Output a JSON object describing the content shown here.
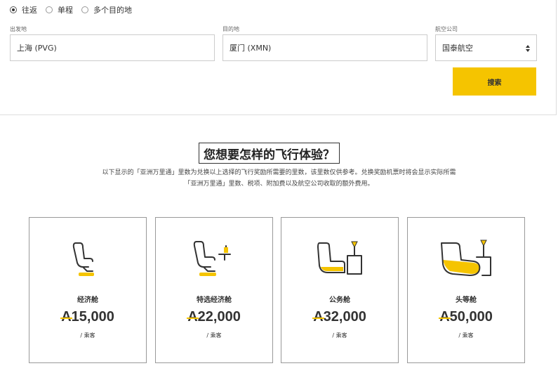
{
  "search": {
    "trip_types": [
      {
        "label": "往返",
        "checked": true
      },
      {
        "label": "单程",
        "checked": false
      },
      {
        "label": "多个目的地",
        "checked": false
      }
    ],
    "origin_label": "出发地",
    "origin_value": "上海 (PVG)",
    "destination_label": "目的地",
    "destination_value": "厦门 (XMN)",
    "airline_label": "航空公司",
    "airline_value": "国泰航空",
    "search_button": "搜索"
  },
  "experience": {
    "title": "您想要怎样的飞行体验？",
    "description_line1": "以下显示的「亚洲万里通」里数为兑换以上选择的飞行奖励所需要的里数，该里数仅供参考。兑换奖励机票时将会显示实际所需",
    "description_line2": "「亚洲万里通」里数、税项、附加费以及航空公司收取的额外费用。"
  },
  "cabins": [
    {
      "icon": "economy-seat-icon",
      "name": "经济舱",
      "currency": "A",
      "miles": "15,000",
      "per": "/ 乘客"
    },
    {
      "icon": "premium-economy-seat-icon",
      "name": "特选经济舱",
      "currency": "A",
      "miles": "22,000",
      "per": "/ 乘客"
    },
    {
      "icon": "business-seat-icon",
      "name": "公务舱",
      "currency": "A",
      "miles": "32,000",
      "per": "/ 乘客"
    },
    {
      "icon": "first-class-seat-icon",
      "name": "头等舱",
      "currency": "A",
      "miles": "50,000",
      "per": "/ 乘客"
    }
  ],
  "colors": {
    "accent": "#f5c400",
    "border": "#cccccc",
    "text": "#333333"
  }
}
